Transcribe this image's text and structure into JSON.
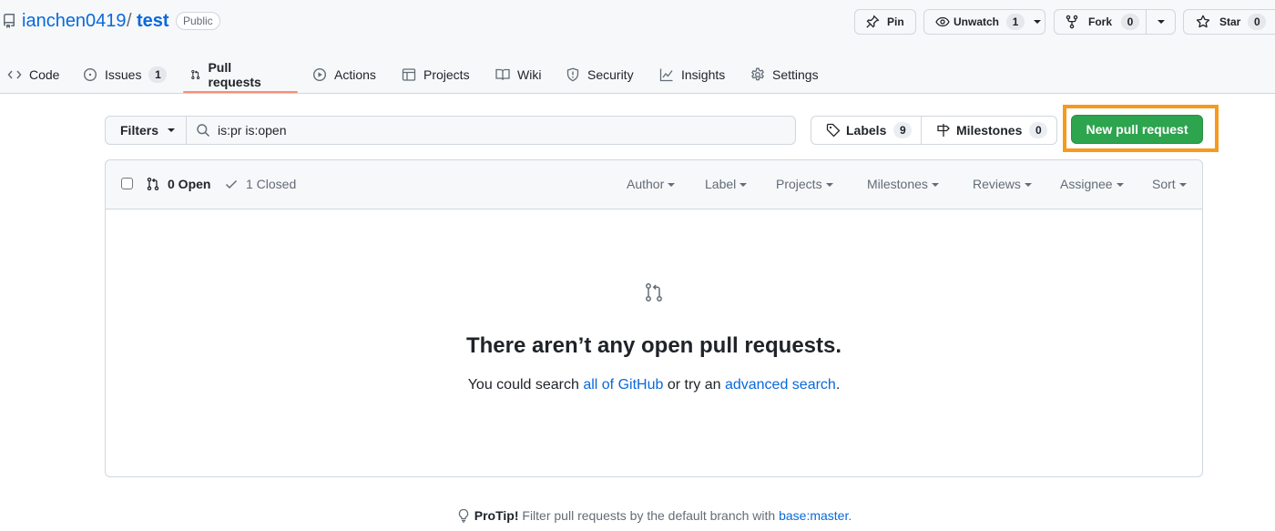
{
  "repo": {
    "owner": "ianchen0419",
    "separator": "/",
    "name": "test",
    "visibility": "Public"
  },
  "actions": {
    "pin_label": "Pin",
    "unwatch_label": "Unwatch",
    "watch_count": "1",
    "fork_label": "Fork",
    "fork_count": "0",
    "star_label": "Star",
    "star_count": "0"
  },
  "tabs": [
    {
      "label": "Code",
      "icon": "code-icon"
    },
    {
      "label": "Issues",
      "icon": "issue-opened-icon",
      "count": "1"
    },
    {
      "label": "Pull requests",
      "icon": "git-pull-request-icon",
      "selected": true
    },
    {
      "label": "Actions",
      "icon": "play-icon"
    },
    {
      "label": "Projects",
      "icon": "table-icon"
    },
    {
      "label": "Wiki",
      "icon": "book-icon"
    },
    {
      "label": "Security",
      "icon": "shield-icon"
    },
    {
      "label": "Insights",
      "icon": "graph-icon"
    },
    {
      "label": "Settings",
      "icon": "gear-icon"
    }
  ],
  "toolbar": {
    "filters_label": "Filters",
    "search_value": "is:pr is:open",
    "labels_label": "Labels",
    "labels_count": "9",
    "milestones_label": "Milestones",
    "milestones_count": "0",
    "new_pr_label": "New pull request",
    "new_pr_color": "#2da44e",
    "highlight_color": "#f79a1c"
  },
  "list_header": {
    "open_label": "0 Open",
    "closed_label": "1 Closed",
    "filters": [
      "Author",
      "Label",
      "Projects",
      "Milestones",
      "Reviews",
      "Assignee",
      "Sort"
    ]
  },
  "blankslate": {
    "title": "There aren’t any open pull requests.",
    "text_prefix": "You could search ",
    "link_all": "all of GitHub",
    "text_middle": " or try an ",
    "link_advanced": "advanced search",
    "text_suffix": "."
  },
  "protip": {
    "label": "ProTip!",
    "text": " Filter pull requests by the default branch with ",
    "link": "base:master",
    "suffix": "."
  }
}
